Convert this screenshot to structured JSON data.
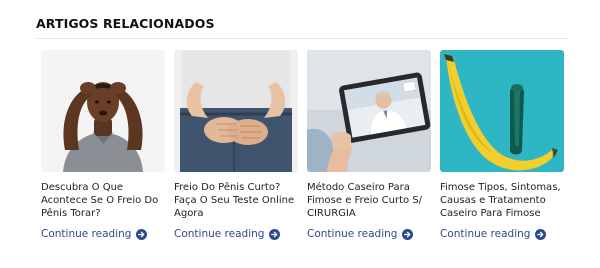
{
  "section": {
    "title": "ARTIGOS RELACIONADOS"
  },
  "colors": {
    "link": "#2b4a8c",
    "title": "#111111",
    "text": "#222222"
  },
  "articles": [
    {
      "title": "Descubra O Que Acontece Se O Freio Do Pênis Torar?",
      "link_label": "Continue reading",
      "image": "man-holding-head-photo",
      "icon": "arrow-circle-right-icon"
    },
    {
      "title": "Freio Do Pênis Curto? Faça O Seu Teste Online Agora",
      "link_label": "Continue reading",
      "image": "man-hands-crotch-photo",
      "icon": "arrow-circle-right-icon"
    },
    {
      "title": "Método Caseiro Para Fimose e Freio Curto S/ CIRURGIA",
      "link_label": "Continue reading",
      "image": "doctor-video-call-tablet-photo",
      "icon": "arrow-circle-right-icon"
    },
    {
      "title": "Fimose Tipos, Sintomas, Causas e Tratamento Caseiro Para Fimose",
      "link_label": "Continue reading",
      "image": "banana-and-cucumber-photo",
      "icon": "arrow-circle-right-icon"
    }
  ]
}
